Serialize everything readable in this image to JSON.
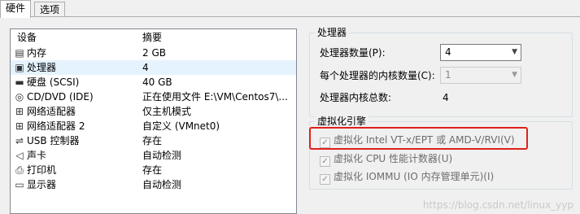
{
  "tabs": [
    {
      "label": "硬件"
    },
    {
      "label": "选项"
    }
  ],
  "device_list": {
    "columns": [
      "设备",
      "摘要"
    ],
    "rows": [
      {
        "icon": "memory-icon",
        "name": "内存",
        "summary": "2 GB"
      },
      {
        "icon": "cpu-icon",
        "name": "处理器",
        "summary": "4",
        "selected": true
      },
      {
        "icon": "disk-icon",
        "name": "硬盘 (SCSI)",
        "summary": "40 GB"
      },
      {
        "icon": "cd-icon",
        "name": "CD/DVD (IDE)",
        "summary": "正在使用文件 E:\\VM\\Centos7\\..."
      },
      {
        "icon": "network-icon",
        "name": "网络适配器",
        "summary": "仅主机模式"
      },
      {
        "icon": "network-icon",
        "name": "网络适配器 2",
        "summary": "自定义 (VMnet0)"
      },
      {
        "icon": "usb-icon",
        "name": "USB 控制器",
        "summary": "存在"
      },
      {
        "icon": "speaker-icon",
        "name": "声卡",
        "summary": "自动检测"
      },
      {
        "icon": "printer-icon",
        "name": "打印机",
        "summary": "存在"
      },
      {
        "icon": "display-icon",
        "name": "显示器",
        "summary": "自动检测"
      }
    ]
  },
  "processor": {
    "title": "处理器",
    "count_label": "处理器数量(P):",
    "count_value": "4",
    "cores_label": "每个处理器的内核数量(C):",
    "cores_value": "1",
    "total_label": "处理器内核总数:",
    "total_value": "4"
  },
  "virtualization": {
    "title": "虚拟化引擎",
    "options": [
      {
        "label": "虚拟化 Intel VT-x/EPT 或 AMD-V/RVI(V)",
        "checked": true
      },
      {
        "label": "虚拟化 CPU 性能计数器(U)",
        "checked": true
      },
      {
        "label": "虚拟化 IOMMU (IO 内存管理单元)(I)",
        "checked": true
      }
    ]
  },
  "watermark": "https://blog.csdn.net/linux_yyp",
  "colors": {
    "highlight_box": "#e0201b",
    "selected_row": "#e5f3ff"
  }
}
